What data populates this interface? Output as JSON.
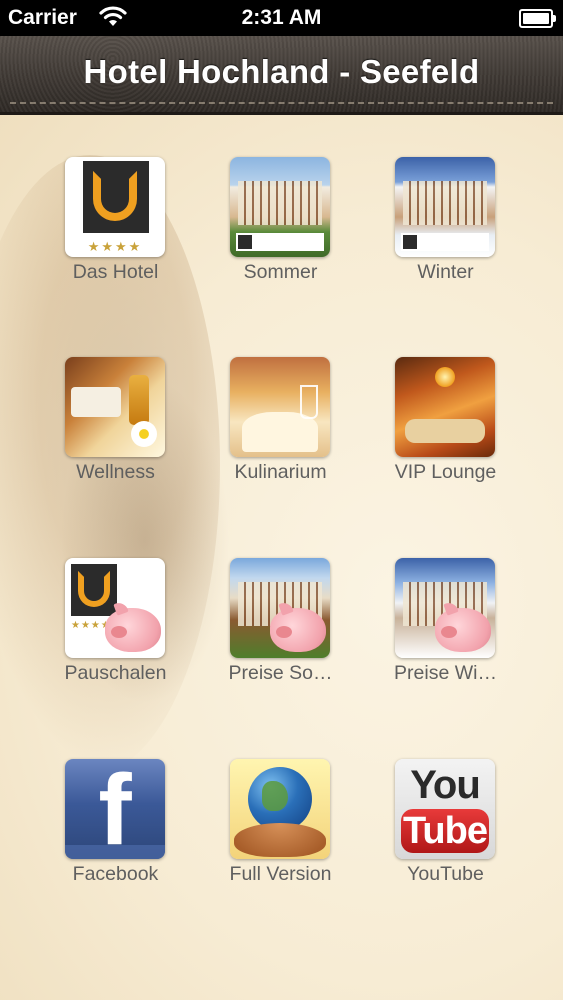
{
  "status_bar": {
    "carrier": "Carrier",
    "time": "2:31 AM",
    "wifi_icon": "wifi-icon",
    "battery_icon": "battery-icon"
  },
  "nav_bar": {
    "title": "Hotel Hochland - Seefeld"
  },
  "tiles": [
    {
      "label": "Das Hotel",
      "icon": "hotel-logo-icon"
    },
    {
      "label": "Sommer",
      "icon": "summer-hotel-photo-icon"
    },
    {
      "label": "Winter",
      "icon": "winter-hotel-photo-icon"
    },
    {
      "label": "Wellness",
      "icon": "wellness-spa-icon"
    },
    {
      "label": "Kulinarium",
      "icon": "dining-table-icon"
    },
    {
      "label": "VIP Lounge",
      "icon": "lounge-interior-icon"
    },
    {
      "label": "Pauschalen",
      "icon": "packages-piggybank-icon"
    },
    {
      "label": "Preise So…",
      "icon": "summer-prices-piggybank-icon"
    },
    {
      "label": "Preise Wi…",
      "icon": "winter-prices-piggybank-icon"
    },
    {
      "label": "Facebook",
      "icon": "facebook-icon"
    },
    {
      "label": "Full Version",
      "icon": "globe-in-hands-icon"
    },
    {
      "label": "YouTube",
      "icon": "youtube-icon"
    }
  ],
  "icon_text": {
    "stars": "★★★★",
    "facebook_letter": "f",
    "youtube_you": "You",
    "youtube_tube": "Tube"
  },
  "colors": {
    "label_text": "#5f5f5f",
    "nav_bar_leather": "#3f3934",
    "background_cream": "#f6ecd4"
  }
}
